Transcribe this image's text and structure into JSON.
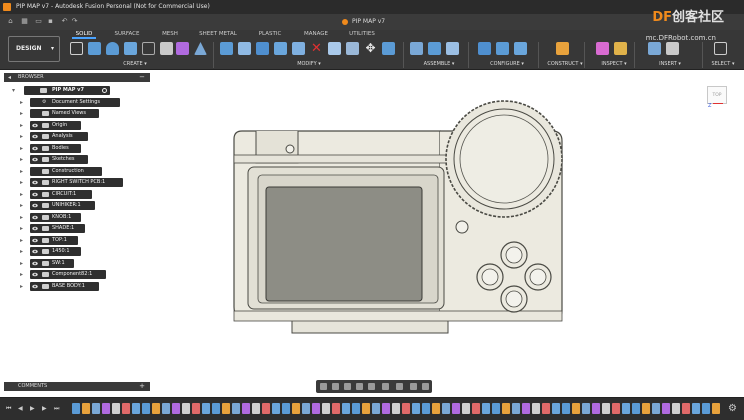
{
  "window": {
    "title": "PIP MAP v7 - Autodesk Fusion Personal (Not for Commercial Use)"
  },
  "document": {
    "tab_title": "PIP MAP v7"
  },
  "brand": {
    "line1_prefix": "DF",
    "line1_rest": "创客社区",
    "line2": "mc.DFRobot.com.cn"
  },
  "workspace": {
    "label": "DESIGN",
    "caret": "▾"
  },
  "ribbon_tabs": [
    {
      "label": "SOLID",
      "active": true
    },
    {
      "label": "SURFACE",
      "active": false
    },
    {
      "label": "MESH",
      "active": false
    },
    {
      "label": "SHEET METAL",
      "active": false
    },
    {
      "label": "PLASTIC",
      "active": false
    },
    {
      "label": "MANAGE",
      "active": false
    },
    {
      "label": "UTILITIES",
      "active": false
    }
  ],
  "ribbon_groups": [
    {
      "label": "CREATE ▾"
    },
    {
      "label": "MODIFY ▾"
    },
    {
      "label": "ASSEMBLE ▾"
    },
    {
      "label": "CONFIGURE ▾"
    },
    {
      "label": "CONSTRUCT ▾"
    },
    {
      "label": "INSPECT ▾"
    },
    {
      "label": "INSERT ▾"
    },
    {
      "label": "SELECT ▾"
    }
  ],
  "browser": {
    "header": "BROWSER",
    "collapse_glyph": "◂",
    "minus_glyph": "−",
    "root": "PIP MAP v7",
    "items": [
      {
        "label": "Document Settings",
        "level": 1,
        "eye": false,
        "icon": "gear-icon"
      },
      {
        "label": "Named Views",
        "level": 1,
        "eye": false,
        "icon": "folder-icon"
      },
      {
        "label": "Origin",
        "level": 1,
        "eye": true,
        "icon": "folder-icon"
      },
      {
        "label": "Analysis",
        "level": 1,
        "eye": true,
        "icon": "folder-icon"
      },
      {
        "label": "Bodies",
        "level": 1,
        "eye": true,
        "icon": "folder-icon"
      },
      {
        "label": "Sketches",
        "level": 1,
        "eye": true,
        "icon": "folder-icon"
      },
      {
        "label": "Construction",
        "level": 1,
        "eye": false,
        "icon": "folder-icon"
      },
      {
        "label": "RIGHT SWITCH PCB:1",
        "level": 1,
        "eye": true,
        "icon": "component-icon"
      },
      {
        "label": "CIRCUIT:1",
        "level": 1,
        "eye": true,
        "icon": "component-icon"
      },
      {
        "label": "UNIHIKER:1",
        "level": 1,
        "eye": true,
        "icon": "component-icon"
      },
      {
        "label": "KNOB:1",
        "level": 1,
        "eye": true,
        "icon": "component-icon"
      },
      {
        "label": "SHADE:1",
        "level": 1,
        "eye": true,
        "icon": "component-icon"
      },
      {
        "label": "TOP:1",
        "level": 1,
        "eye": true,
        "icon": "component-icon"
      },
      {
        "label": "1450:1",
        "level": 1,
        "eye": true,
        "icon": "component-icon"
      },
      {
        "label": "SW:1",
        "level": 1,
        "eye": true,
        "icon": "component-icon"
      },
      {
        "label": "Component82:1",
        "level": 1,
        "eye": true,
        "icon": "component-icon"
      },
      {
        "label": "BASE BODY:1",
        "level": 1,
        "eye": true,
        "icon": "component-icon"
      }
    ]
  },
  "comments": {
    "label": "COMMENTS",
    "plus_glyph": "+"
  },
  "viewcube": {
    "face": "TOP",
    "axis_z": "Z"
  },
  "colors": {
    "titlebar": "#2b2b2b",
    "ribbon": "#373737",
    "accent": "#4aa3ff",
    "model_body": "#eceae0",
    "model_outline": "#4a4a44",
    "screen": "#8d8d85",
    "viewport_bg": "#ffffff"
  },
  "icons": {
    "home": "home-icon",
    "grid": "grid-icon",
    "file": "file-icon",
    "save": "save-icon",
    "undo": "undo-icon",
    "redo": "redo-icon"
  }
}
